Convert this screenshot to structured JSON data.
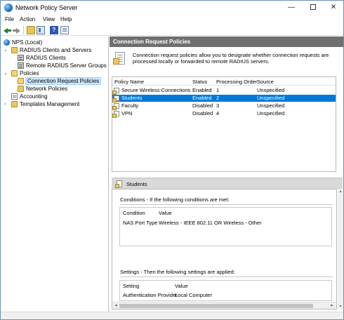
{
  "window": {
    "title": "Network Policy Server",
    "controls": {
      "minimize": "—",
      "close": "✕"
    }
  },
  "menu": {
    "items": [
      {
        "label": "File"
      },
      {
        "label": "Action"
      },
      {
        "label": "View"
      },
      {
        "label": "Help"
      }
    ]
  },
  "toolbar": {
    "help": "?"
  },
  "tree": {
    "root": "NPS (Local)",
    "radius_clients_servers": "RADIUS Clients and Servers",
    "radius_clients": "RADIUS Clients",
    "remote_groups": "Remote RADIUS Server Groups",
    "policies": "Policies",
    "connection_request_policies": "Connection Request Policies",
    "network_policies": "Network Policies",
    "accounting": "Accounting",
    "templates": "Templates Management",
    "expand_open": "⌄",
    "expand_closed": "›"
  },
  "main": {
    "header": "Connection Request Policies",
    "description": "Connection request policies allow you to designate whether connection requests are processed locally or forwarded to remote RADIUS servers.",
    "columns": [
      "Policy Name",
      "Status",
      "Processing Order",
      "Source"
    ],
    "rows": [
      {
        "name": "Secure Wireless Connections",
        "status": "Enabled",
        "order": "1",
        "source": "Unspecified"
      },
      {
        "name": "Students",
        "status": "Enabled",
        "order": "2",
        "source": "Unspecified"
      },
      {
        "name": "Faculty",
        "status": "Disabled",
        "order": "3",
        "source": "Unspecified"
      },
      {
        "name": "VPN",
        "status": "Disabled",
        "order": "4",
        "source": "Unspecified"
      }
    ],
    "selected_row": 1
  },
  "details": {
    "title": "Students",
    "conditions_title": "Conditions - If the following conditions are met:",
    "conditions_columns": [
      "Condition",
      "Value"
    ],
    "conditions": [
      {
        "condition": "NAS Port Type",
        "value": "Wireless - IEEE 802.11 OR Wireless - Other"
      }
    ],
    "settings_title": "Settings - Then the following settings are applied:",
    "settings_columns": [
      "Setting",
      "Value"
    ],
    "settings": [
      {
        "setting": "Authentication Provider",
        "value": "Local Computer"
      }
    ],
    "scroll": {
      "left": "◂",
      "right": "▸",
      "up": "▴",
      "down": "▾"
    }
  }
}
